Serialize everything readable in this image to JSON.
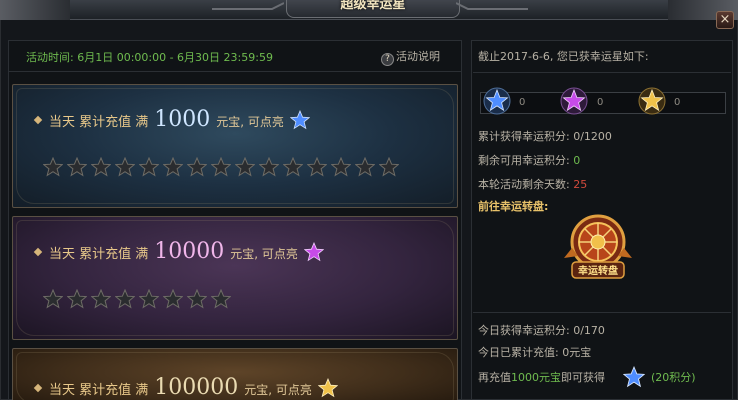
{
  "window": {
    "title": "超级幸运星",
    "close_label": "×"
  },
  "activity": {
    "time_text": "活动时间:  6月1日  00:00:00  -  6月30日  23:59:59",
    "help_label": "活动说明",
    "help_icon": "?"
  },
  "tiers": [
    {
      "prefix": "当天 累计充值 满",
      "amount": "1000",
      "suffix": "元宝, 可点亮",
      "star_color": "blue",
      "star_slots": 15,
      "lit": 0
    },
    {
      "prefix": "当天 累计充值 满",
      "amount": "10000",
      "suffix": "元宝, 可点亮",
      "star_color": "purple",
      "star_slots": 8,
      "lit": 0
    },
    {
      "prefix": "当天 累计充值 满",
      "amount": "100000",
      "suffix": "元宝, 可点亮",
      "star_color": "gold",
      "star_slots": 0,
      "lit": 0
    }
  ],
  "summary": {
    "header": "截止2017-6-6, 您已获幸运星如下:",
    "owned": [
      {
        "color": "blue",
        "count": "0"
      },
      {
        "color": "purple",
        "count": "0"
      },
      {
        "color": "gold",
        "count": "0"
      }
    ],
    "points_label": "累计获得幸运积分:",
    "points_value": "0/1200",
    "remaining_label": "剩余可用幸运积分:",
    "remaining_value": "0",
    "days_label": "本轮活动剩余天数:",
    "days_value": "25",
    "wheel_link": "前往幸运转盘:",
    "wheel_caption": "幸运转盘",
    "today_points_label": "今日获得幸运积分:",
    "today_points_value": "0/170",
    "today_recharge_label": "今日已累计充值:",
    "today_recharge_value": "0元宝",
    "next_prefix": "再充值",
    "next_amount": "1000元宝",
    "next_mid": "即可获得",
    "next_reward": "(20积分)"
  },
  "colors": {
    "blue": "#4f8dff",
    "purple": "#c74be8",
    "gold": "#f0c24a"
  }
}
